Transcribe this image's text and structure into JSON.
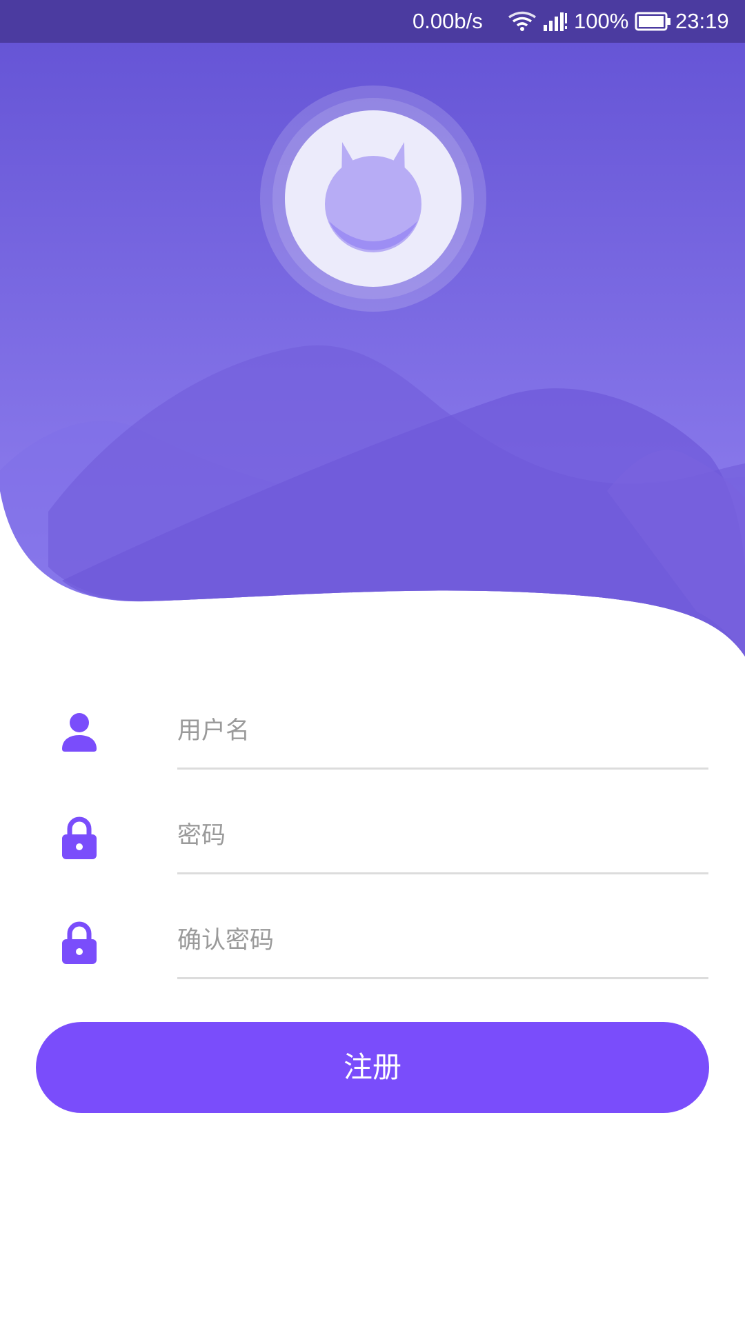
{
  "status_bar": {
    "network_speed": "0.00b/s",
    "battery_percent": "100%",
    "time": "23:19",
    "wifi_icon": "wifi-icon",
    "signal_icon": "cellular-signal-icon",
    "battery_icon": "battery-full-icon"
  },
  "header": {
    "logo_icon": "cat-head-logo-icon",
    "background_art": "purple-mountains-illustration"
  },
  "form": {
    "username": {
      "icon": "person-icon",
      "placeholder": "用户名",
      "value": ""
    },
    "password": {
      "icon": "lock-icon",
      "placeholder": "密码",
      "value": ""
    },
    "confirm_password": {
      "icon": "lock-icon",
      "placeholder": "确认密码",
      "value": ""
    },
    "register_label": "注册"
  },
  "colors": {
    "accent": "#7a4dfb",
    "status_bar": "#4b3ba0",
    "header_top": "#6655d6",
    "header_bottom": "#8f7df0",
    "icon": "#7a4dfb",
    "underline": "#dcdcdc",
    "placeholder": "#9a9a9a"
  }
}
